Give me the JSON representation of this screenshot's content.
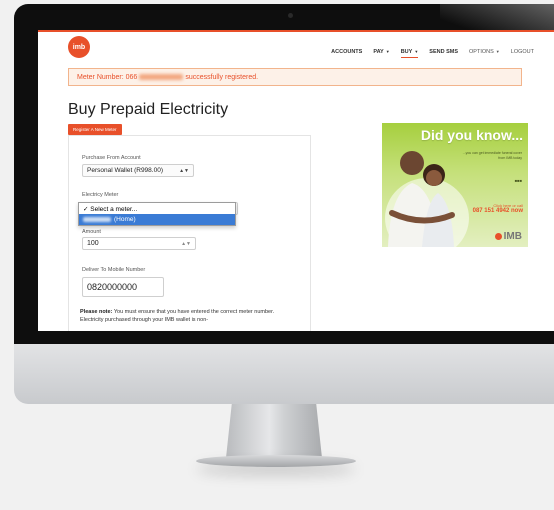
{
  "header": {
    "logo_text": "imb",
    "nav": [
      {
        "label": "ACCOUNTS"
      },
      {
        "label": "PAY",
        "caret": "▼"
      },
      {
        "label": "BUY",
        "caret": "▼",
        "active": true
      },
      {
        "label": "SEND SMS"
      },
      {
        "label": "OPTIONS",
        "caret": "▼"
      },
      {
        "label": "LOGOUT"
      }
    ]
  },
  "alert": {
    "prefix": "Meter Number: 066",
    "suffix": "successfully registered."
  },
  "page": {
    "title": "Buy Prepaid Electricity",
    "register_button": "Register A New Meter"
  },
  "form": {
    "account_label": "Purchase From Account",
    "account_value": "Personal Wallet (R998.00)",
    "meter_label": "Electricy Meter",
    "meter_options": [
      "✓ Select a meter...",
      "(Home)"
    ],
    "amount_label": "Amount",
    "amount_value": "100",
    "mobile_label": "Deliver To Mobile Number",
    "mobile_value": "0820000000",
    "note_bold": "Please note:",
    "note_text": "You must ensure that you have entered the correct meter number. Electricity purchased through your IMB wallet is non-"
  },
  "ad": {
    "title": "Did you know...",
    "small_text": "...you can get immediate funeral cover from IMB today",
    "contact_small": "Click here or call",
    "contact_number": "087 151 4942 now",
    "brand": "IMB"
  },
  "colors": {
    "accent": "#e8502a",
    "ad_green": "#a6cf3e",
    "highlight": "#3a7bd5"
  }
}
